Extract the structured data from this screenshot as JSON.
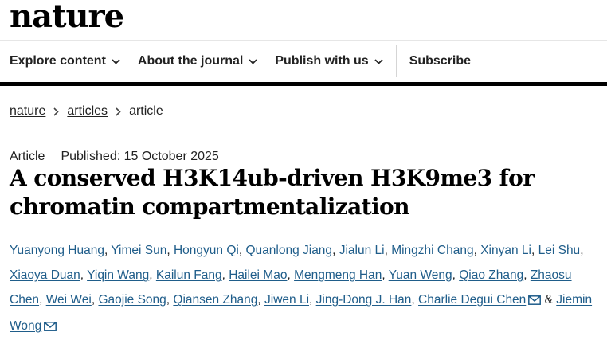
{
  "brand": {
    "logo": "nature"
  },
  "nav": {
    "explore": "Explore content",
    "about": "About the journal",
    "publish": "Publish with us",
    "subscribe": "Subscribe"
  },
  "breadcrumb": [
    "nature",
    "articles",
    "article"
  ],
  "article": {
    "type": "Article",
    "published": "Published: 15 October 2025",
    "title": "A conserved H3K14ub-driven H3K9me3 for chromatin compartmentalization"
  },
  "authors": [
    "Yuanyong Huang",
    "Yimei Sun",
    "Hongyun Qi",
    "Quanlong Jiang",
    "Jialun Li",
    "Mingzhi Chang",
    "Xinyan Li",
    "Lei Shu",
    "Xiaoya Duan",
    "Yiqin Wang",
    "Kailun Fang",
    "Hailei Mao",
    "Mengmeng Han",
    "Yuan Weng",
    "Qiao Zhang",
    "Zhaosu Chen",
    "Wei Wei",
    "Gaojie Song",
    "Qiansen Zhang",
    "Jiwen Li",
    "Jing-Dong J. Han",
    "Charlie Degui Chen",
    "Jiemin Wong"
  ],
  "author_separator": ",",
  "author_final_joiner": "&",
  "colors": {
    "link": "#1f5d8a",
    "rule": "#000000",
    "text": "#222222"
  },
  "icons": {
    "menu_chevron": "chevron-down-icon",
    "crumb_sep": "chevron-right-icon",
    "contact": "envelope-icon"
  }
}
